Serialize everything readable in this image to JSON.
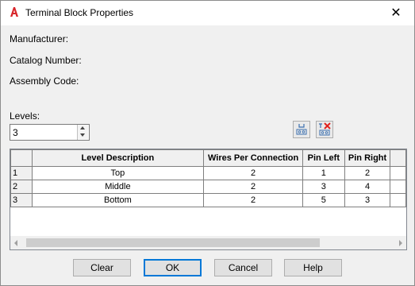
{
  "window": {
    "title": "Terminal Block Properties",
    "close_glyph": "✕"
  },
  "fields": {
    "manufacturer_label": "Manufacturer:",
    "catalog_label": "Catalog Number:",
    "assembly_label": "Assembly Code:",
    "levels_label": "Levels:",
    "levels_value": "3"
  },
  "table": {
    "headers": [
      "Level Description",
      "Wires Per Connection",
      "Pin Left",
      "Pin Right"
    ],
    "rows": [
      {
        "num": "1",
        "desc": "Top",
        "wires": "2",
        "pin_left": "1",
        "pin_right": "2"
      },
      {
        "num": "2",
        "desc": "Middle",
        "wires": "2",
        "pin_left": "3",
        "pin_right": "4"
      },
      {
        "num": "3",
        "desc": "Bottom",
        "wires": "2",
        "pin_left": "5",
        "pin_right": "3"
      }
    ]
  },
  "buttons": {
    "clear": "Clear",
    "ok": "OK",
    "cancel": "Cancel",
    "help": "Help"
  },
  "colors": {
    "accent": "#0078d7",
    "app_icon": "#d8262b",
    "delete_icon": "#e0201c"
  }
}
